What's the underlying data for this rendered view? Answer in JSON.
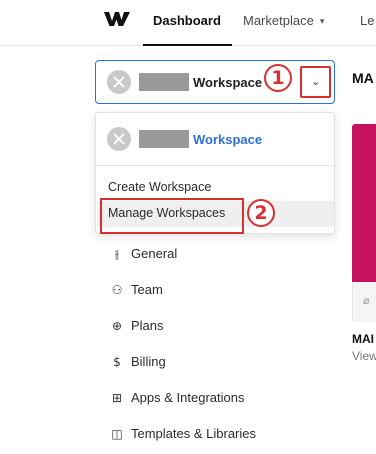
{
  "nav": {
    "tabs": [
      {
        "label": "Dashboard",
        "active": true
      },
      {
        "label": "Marketplace",
        "active": false
      },
      {
        "label": "Le",
        "active": false
      }
    ]
  },
  "switcher": {
    "workspace_name": "Workspace",
    "callout": "1"
  },
  "dropdown": {
    "current_workspace": "Workspace",
    "items": [
      {
        "label": "Create Workspace"
      },
      {
        "label": "Manage Workspaces"
      }
    ],
    "callout": "2"
  },
  "menu": [
    {
      "label": "General",
      "icon": "sliders-icon",
      "glyph": "⫲"
    },
    {
      "label": "Team",
      "icon": "team-icon",
      "glyph": "⚇"
    },
    {
      "label": "Plans",
      "icon": "plans-icon",
      "glyph": "⊕"
    },
    {
      "label": "Billing",
      "icon": "dollar-icon",
      "glyph": "$"
    },
    {
      "label": "Apps & Integrations",
      "icon": "apps-icon",
      "glyph": "⊞"
    },
    {
      "label": "Templates & Libraries",
      "icon": "templates-icon",
      "glyph": "◫"
    }
  ],
  "right_panel": {
    "title": "MA",
    "card_title": "MAI",
    "card_sub": "View"
  },
  "colors": {
    "accent": "#2f6fdc",
    "annotation": "#d83030",
    "card": "#c5125f"
  }
}
